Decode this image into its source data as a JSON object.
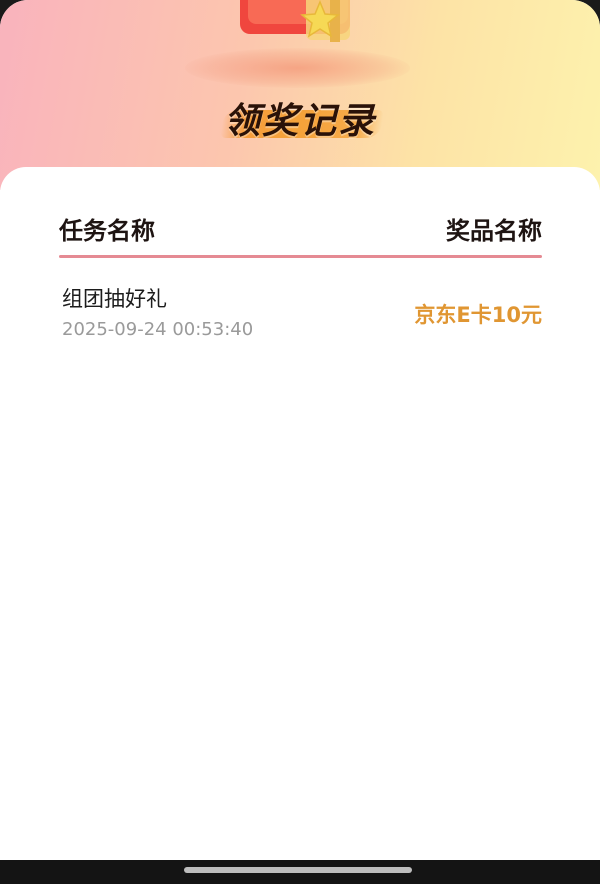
{
  "header": {
    "title": "领奖记录",
    "gift_icon": "gift-box-star-icon"
  },
  "table": {
    "columns": [
      "任务名称",
      "奖品名称"
    ],
    "rows": [
      {
        "task_name": "组团抽好礼",
        "time": "2025-09-24 00:53:40",
        "prize": "京东E卡10元"
      }
    ]
  },
  "colors": {
    "divider": "#e58a93",
    "prize": "#e09632",
    "header_gradient_start": "#f9b3bd",
    "header_gradient_end": "#fdf2ad"
  }
}
